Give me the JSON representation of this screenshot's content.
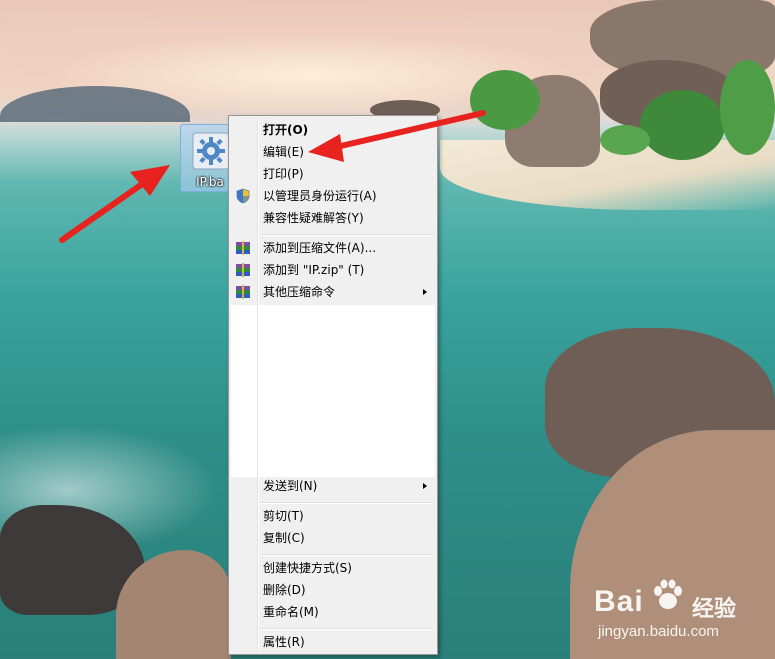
{
  "desktop": {
    "file_icon": {
      "label": "IP.ba",
      "icon": "gear-file-icon"
    },
    "watermark": {
      "logo": "Bai",
      "suffix": "经验",
      "url": "jingyan.baidu.com",
      "icon": "baidu-paw-icon"
    }
  },
  "context_menu": {
    "items": [
      {
        "label": "打开(O)",
        "bold": true
      },
      {
        "label": "编辑(E)"
      },
      {
        "label": "打印(P)"
      },
      {
        "label": "以管理员身份运行(A)",
        "icon": "uac-shield-icon"
      },
      {
        "label": "兼容性疑难解答(Y)"
      },
      {
        "label": "添加到压缩文件(A)...",
        "icon": "winrar-icon"
      },
      {
        "label": "添加到 \"IP.zip\" (T)",
        "icon": "winrar-icon"
      },
      {
        "label": "其他压缩命令",
        "icon": "winrar-icon",
        "submenu": true
      },
      {
        "label": "发送到(N)",
        "submenu": true
      },
      {
        "label": "剪切(T)"
      },
      {
        "label": "复制(C)"
      },
      {
        "label": "创建快捷方式(S)"
      },
      {
        "label": "删除(D)"
      },
      {
        "label": "重命名(M)"
      },
      {
        "label": "属性(R)"
      }
    ]
  },
  "annotations": {
    "arrow_color": "#e8231f"
  }
}
